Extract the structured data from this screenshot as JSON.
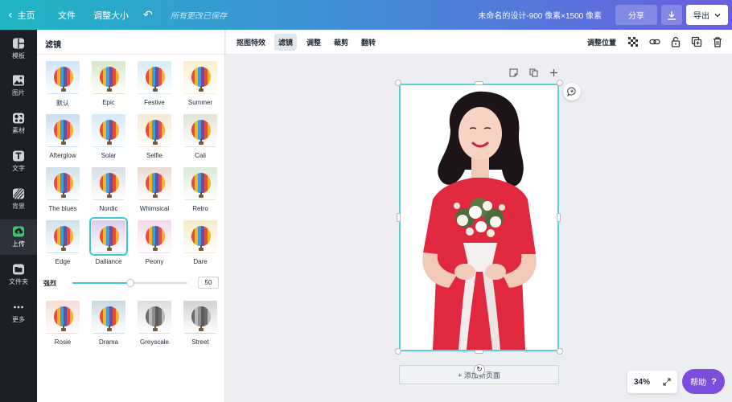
{
  "topbar": {
    "home_label": "主页",
    "file_label": "文件",
    "resize_label": "调整大小",
    "undo_icon": "undo-icon",
    "saved_status": "所有更改已保存",
    "design_title": "未命名的设计-900 像素×1500 像素",
    "share_label": "分享",
    "download_icon": "download-icon",
    "export_label": "导出"
  },
  "rail": {
    "items": [
      {
        "label": "模板",
        "icon": "template-icon"
      },
      {
        "label": "图片",
        "icon": "image-icon"
      },
      {
        "label": "素材",
        "icon": "elements-icon"
      },
      {
        "label": "文字",
        "icon": "text-icon"
      },
      {
        "label": "背景",
        "icon": "background-icon"
      },
      {
        "label": "上传",
        "icon": "upload-icon"
      },
      {
        "label": "文件夹",
        "icon": "folder-icon"
      },
      {
        "label": "更多",
        "icon": "more-icon"
      }
    ]
  },
  "panel": {
    "title": "滤镜",
    "filters": [
      {
        "name": "默认",
        "tint": "#cfe3f5"
      },
      {
        "name": "Epic",
        "tint": "#d7e6c9"
      },
      {
        "name": "Festive",
        "tint": "#d4ecf7"
      },
      {
        "name": "Summer",
        "tint": "#f7efcf"
      },
      {
        "name": "Afterglow",
        "tint": "#c9dcf0"
      },
      {
        "name": "Solar",
        "tint": "#d3e9f8"
      },
      {
        "name": "Selfie",
        "tint": "#f2ead2"
      },
      {
        "name": "Cali",
        "tint": "#dfe3d6"
      },
      {
        "name": "The blues",
        "tint": "#cfe0e6"
      },
      {
        "name": "Nordic",
        "tint": "#d9dde2"
      },
      {
        "name": "Whimsical",
        "tint": "#ead9cf"
      },
      {
        "name": "Retro",
        "tint": "#d8ead4"
      },
      {
        "name": "Edge",
        "tint": "#cfe2e9"
      },
      {
        "name": "Dalliance",
        "tint": "#d9cfe8"
      },
      {
        "name": "Peony",
        "tint": "#f2d9ea"
      },
      {
        "name": "Dare",
        "tint": "#f4ecc9"
      }
    ],
    "selected_filter": "Dalliance",
    "strength_label": "强烈",
    "strength_value": "50",
    "strength_fraction": 0.5,
    "more_filters": [
      {
        "name": "Rosie",
        "tint": "#f5dcd6"
      },
      {
        "name": "Drama",
        "tint": "#c9d9e0"
      },
      {
        "name": "Greyscale",
        "tint": "#dedede"
      },
      {
        "name": "Street",
        "tint": "#d2d2d2"
      }
    ]
  },
  "edit_toolbar": {
    "tabs": [
      {
        "label": "抠图特效",
        "active": false
      },
      {
        "label": "滤镜",
        "active": true
      },
      {
        "label": "调整",
        "active": false
      },
      {
        "label": "裁剪",
        "active": false
      },
      {
        "label": "翻转",
        "active": false
      }
    ],
    "position_label": "调整位置",
    "icons": [
      "transparency-icon",
      "link-icon",
      "lock-icon",
      "duplicate-icon",
      "trash-icon"
    ]
  },
  "canvas": {
    "page_tools": [
      "note-icon",
      "copy-icon",
      "plus-icon"
    ],
    "add_page_label": "+ 添加新页面",
    "zoom_level": "34%",
    "help_label": "帮助",
    "help_icon": "?"
  },
  "colors": {
    "accent": "#3cc7d2",
    "help": "#7d4ddb",
    "dress": "#e0283e"
  }
}
